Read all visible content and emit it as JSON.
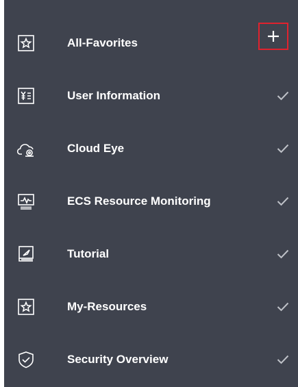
{
  "colors": {
    "background": "#3f434e",
    "text": "#ffffff",
    "icon_stroke": "#ffffff",
    "check": "#bfc2c8",
    "highlight_border": "#e0222e"
  },
  "menu": {
    "items": [
      {
        "label": "All-Favorites",
        "icon": "star-icon",
        "action": "plus-icon"
      },
      {
        "label": "User Information",
        "icon": "id-card-icon",
        "action": "checkmark-icon"
      },
      {
        "label": "Cloud Eye",
        "icon": "cloud-eye-icon",
        "action": "checkmark-icon"
      },
      {
        "label": "ECS Resource Monitoring",
        "icon": "monitor-icon",
        "action": "checkmark-icon"
      },
      {
        "label": "Tutorial",
        "icon": "book-icon",
        "action": "checkmark-icon"
      },
      {
        "label": "My-Resources",
        "icon": "star-icon",
        "action": "checkmark-icon"
      },
      {
        "label": "Security Overview",
        "icon": "shield-icon",
        "action": "checkmark-icon"
      }
    ]
  }
}
